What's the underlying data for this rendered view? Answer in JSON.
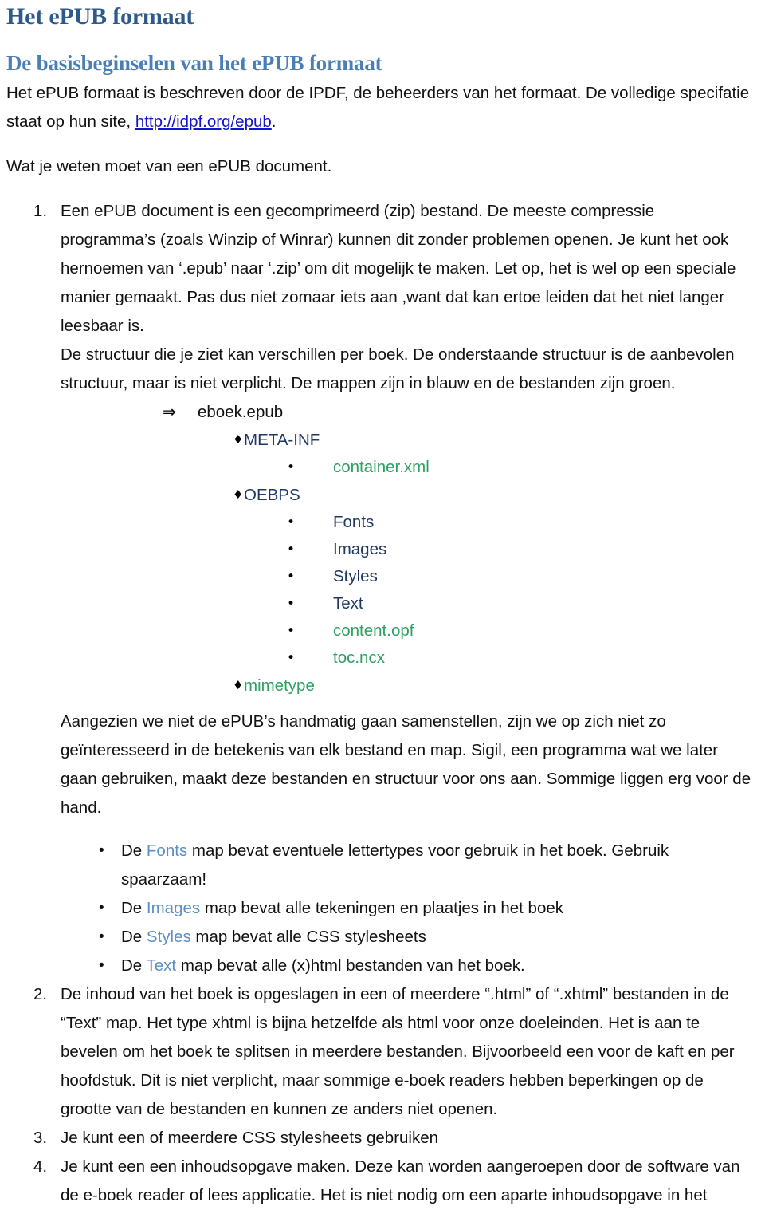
{
  "document": {
    "title": "Het ePUB formaat",
    "subtitle": "De basisbeginselen van het ePUB formaat",
    "intro": {
      "before_link": "Het ePUB formaat is beschreven door de IPDF, de beheerders van het formaat. De volledige specifatie staat op hun site, ",
      "link_text": "http://idpf.org/epub",
      "after_link": "."
    },
    "lead_line": "Wat je weten moet van een ePUB document.",
    "item1": {
      "text": "Een ePUB document is een gecomprimeerd (zip) bestand. De meeste compressie programma’s (zoals Winzip of Winrar) kunnen dit zonder problemen openen. Je kunt het ook hernoemen van ‘.epub’ naar ‘.zip’ om dit mogelijk te maken. Let op, het is wel op een speciale manier gemaakt. Pas dus niet zomaar iets aan ,want dat kan ertoe leiden dat het niet langer leesbaar is.",
      "text2": "De structuur die je ziet kan verschillen per boek. De onderstaande structuur is de aanbevolen structuur, maar is niet verplicht. De mappen zijn in blauw en de bestanden zijn groen."
    },
    "tree": [
      {
        "label": "eboek.epub",
        "marker": "arrow-marker",
        "glyph": "⇒",
        "level": 0,
        "kind": "root"
      },
      {
        "label": "META-INF",
        "marker": "diamond-marker",
        "glyph": "♦",
        "level": 1,
        "kind": "folder"
      },
      {
        "label": "container.xml",
        "marker": "disc-marker",
        "glyph": "•",
        "level": 2,
        "kind": "file"
      },
      {
        "label": "OEBPS",
        "marker": "diamond-marker",
        "glyph": "♦",
        "level": 1,
        "kind": "folder"
      },
      {
        "label": "Fonts",
        "marker": "disc-marker",
        "glyph": "•",
        "level": 2,
        "kind": "folder"
      },
      {
        "label": "Images",
        "marker": "disc-marker",
        "glyph": "•",
        "level": 2,
        "kind": "folder"
      },
      {
        "label": "Styles",
        "marker": "disc-marker",
        "glyph": "•",
        "level": 2,
        "kind": "folder"
      },
      {
        "label": "Text",
        "marker": "disc-marker",
        "glyph": "•",
        "level": 2,
        "kind": "folder"
      },
      {
        "label": "content.opf",
        "marker": "disc-marker",
        "glyph": "•",
        "level": 2,
        "kind": "file"
      },
      {
        "label": "toc.ncx",
        "marker": "disc-marker",
        "glyph": "•",
        "level": 2,
        "kind": "file"
      },
      {
        "label": "mimetype",
        "marker": "diamond-marker",
        "glyph": "♦",
        "level": 1,
        "kind": "file"
      }
    ],
    "paragraph_after_tree": "Aangezien we niet de ePUB’s handmatig gaan samenstellen, zijn we op zich niet zo geïnteresseerd in de betekenis van elk bestand en map. Sigil, een programma wat we later gaan gebruiken, maakt deze bestanden en structuur voor ons aan. Sommige liggen erg voor de hand.",
    "folder_bullets": [
      {
        "prefix": "De ",
        "name": "Fonts",
        "suffix": " map bevat eventuele lettertypes voor gebruik in het boek. Gebruik spaarzaam!"
      },
      {
        "prefix": "De ",
        "name": "Images",
        "suffix": " map bevat alle tekeningen en plaatjes in het boek"
      },
      {
        "prefix": "De ",
        "name": "Styles",
        "suffix": " map bevat alle CSS stylesheets"
      },
      {
        "prefix": "De ",
        "name": "Text",
        "suffix": " map bevat alle (x)html bestanden van het boek."
      }
    ],
    "item2": "De inhoud van het boek is opgeslagen in een of meerdere “.html” of “.xhtml” bestanden in de “Text” map. Het type xhtml is bijna hetzelfde als html voor onze doeleinden. Het is aan te bevelen om het boek te splitsen in meerdere bestanden. Bijvoorbeeld een voor de kaft en per hoofdstuk. Dit is niet verplicht, maar sommige e-boek readers hebben beperkingen op de grootte van de bestanden en kunnen ze anders niet openen.",
    "item3": "Je kunt een of meerdere CSS stylesheets gebruiken",
    "item4": "Je kunt een een inhoudsopgave maken. Deze kan worden aangeroepen door de software van de e-boek reader of lees applicatie. Het is niet nodig om een aparte inhoudsopgave in het"
  },
  "colors": {
    "title": "#2E5A8A",
    "subtitle": "#4A7EB5",
    "link": "#1414C8",
    "folder": "#1F3864",
    "file": "#2EA062",
    "highlight_blue": "#5B8FC7",
    "body_text": "#111111",
    "background": "#FFFFFF"
  }
}
